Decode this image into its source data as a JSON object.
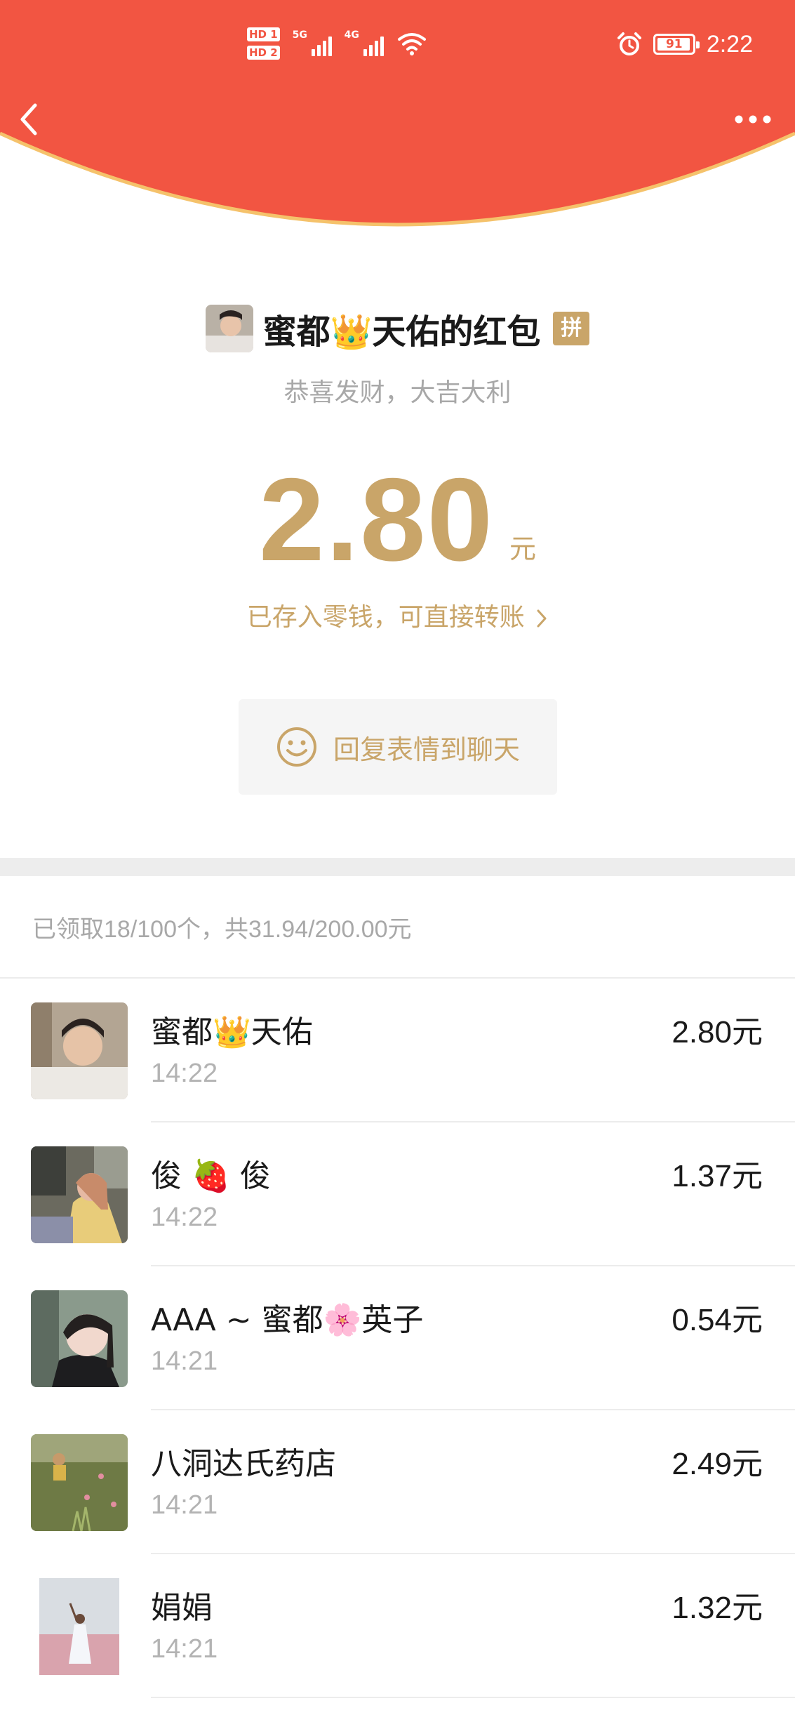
{
  "status_bar": {
    "sim1": "HD 1",
    "sim2": "HD 2",
    "network1": "5G",
    "network2": "4G",
    "battery_percent": "91",
    "time": "2:22"
  },
  "sender": {
    "title": "蜜都👑天佑的红包",
    "group_badge": "拼",
    "blessing": "恭喜发财，大吉大利"
  },
  "amount": {
    "value": "2.80",
    "unit": "元",
    "change_link": "已存入零钱，可直接转账"
  },
  "reply_button": {
    "label": "回复表情到聊天"
  },
  "summary": {
    "text": "已领取18/100个，共31.94/200.00元"
  },
  "receivers": [
    {
      "name": "蜜都👑天佑",
      "time": "14:22",
      "amount": "2.80元"
    },
    {
      "name": "俊 🍓 俊",
      "time": "14:22",
      "amount": "1.37元"
    },
    {
      "name": "AAA ~ 蜜都🌸英子",
      "time": "14:21",
      "amount": "0.54元"
    },
    {
      "name": "八洞达氏药店",
      "time": "14:21",
      "amount": "2.49元"
    },
    {
      "name": "娟娟",
      "time": "14:21",
      "amount": "1.32元"
    }
  ],
  "icons": {
    "back": "back-arrow-icon",
    "more": "more-dots-icon",
    "smile": "smile-icon",
    "chevron": "chevron-right-icon",
    "wifi": "wifi-icon",
    "alarm": "alarm-icon"
  },
  "colors": {
    "header_red": "#f25542",
    "header_edge": "#f5c26b",
    "gold": "#c9a569",
    "muted_text": "#a8a8a8",
    "primary_text": "#1a1a1a"
  }
}
